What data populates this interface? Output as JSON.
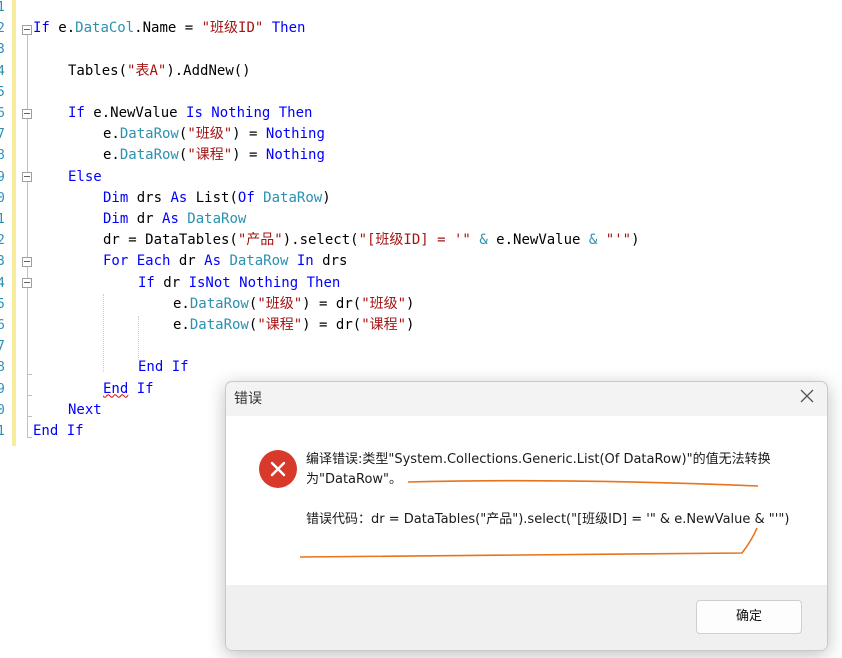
{
  "editor": {
    "line_numbers": [
      "1",
      "2",
      "3",
      "4",
      "5",
      "6",
      "7",
      "8",
      "9",
      "0",
      "1",
      "2",
      "3",
      "4",
      "5",
      "6",
      "7",
      "8",
      "9",
      "0",
      "1"
    ],
    "lines": [
      [],
      [
        [
          "kw",
          "If"
        ],
        [
          "id",
          " e."
        ],
        [
          "typ",
          "DataCol"
        ],
        [
          "id",
          ".Name = "
        ],
        [
          "str",
          "\"班级ID\""
        ],
        [
          "kw",
          " Then"
        ]
      ],
      [],
      [
        [
          "id",
          "Tables("
        ],
        [
          "str",
          "\"表A\""
        ],
        [
          "id",
          ").AddNew()"
        ]
      ],
      [],
      [
        [
          "kw",
          "If"
        ],
        [
          "id",
          " e.NewValue "
        ],
        [
          "kw",
          "Is Nothing Then"
        ]
      ],
      [
        [
          "id",
          "e."
        ],
        [
          "typ",
          "DataRow"
        ],
        [
          "id",
          "("
        ],
        [
          "str",
          "\"班级\""
        ],
        [
          "id",
          ") = "
        ],
        [
          "kw",
          "Nothing"
        ]
      ],
      [
        [
          "id",
          "e."
        ],
        [
          "typ",
          "DataRow"
        ],
        [
          "id",
          "("
        ],
        [
          "str",
          "\"课程\""
        ],
        [
          "id",
          ") = "
        ],
        [
          "kw",
          "Nothing"
        ]
      ],
      [
        [
          "kw",
          "Else"
        ]
      ],
      [
        [
          "kw",
          "Dim"
        ],
        [
          "id",
          " drs "
        ],
        [
          "kw",
          "As"
        ],
        [
          "id",
          " List("
        ],
        [
          "kw",
          "Of"
        ],
        [
          "typ",
          " DataRow"
        ],
        [
          "id",
          ")"
        ]
      ],
      [
        [
          "kw",
          "Dim"
        ],
        [
          "id",
          " dr "
        ],
        [
          "kw",
          "As"
        ],
        [
          "typ",
          " DataRow"
        ]
      ],
      [
        [
          "id",
          "dr = DataTables("
        ],
        [
          "str",
          "\"产品\""
        ],
        [
          "id",
          ").select("
        ],
        [
          "str",
          "\"[班级ID] = '\""
        ],
        [
          "id",
          " "
        ],
        [
          "typ",
          "&"
        ],
        [
          "id",
          " e.NewValue "
        ],
        [
          "typ",
          "&"
        ],
        [
          "str",
          " \"'\""
        ],
        [
          "id",
          ")"
        ]
      ],
      [
        [
          "kw",
          "For Each"
        ],
        [
          "id",
          " dr "
        ],
        [
          "kw",
          "As"
        ],
        [
          "typ",
          " DataRow"
        ],
        [
          "kw",
          " In"
        ],
        [
          "id",
          " drs"
        ]
      ],
      [
        [
          "kw",
          "If"
        ],
        [
          "id",
          " dr "
        ],
        [
          "kw",
          "IsNot Nothing Then"
        ]
      ],
      [
        [
          "id",
          "e."
        ],
        [
          "typ",
          "DataRow"
        ],
        [
          "id",
          "("
        ],
        [
          "str",
          "\"班级\""
        ],
        [
          "id",
          ") = dr("
        ],
        [
          "str",
          "\"班级\""
        ],
        [
          "id",
          ")"
        ]
      ],
      [
        [
          "id",
          "e."
        ],
        [
          "typ",
          "DataRow"
        ],
        [
          "id",
          "("
        ],
        [
          "str",
          "\"课程\""
        ],
        [
          "id",
          ") = dr("
        ],
        [
          "str",
          "\"课程\""
        ],
        [
          "id",
          ")"
        ]
      ],
      [],
      [
        [
          "kw",
          "End If"
        ]
      ],
      [
        [
          "kw",
          "End If"
        ]
      ],
      [
        [
          "kw",
          "Next"
        ]
      ],
      [
        [
          "kw",
          "End If"
        ]
      ]
    ]
  },
  "dialog": {
    "title": "错误",
    "message": "编译错误:类型\"System.Collections.Generic.List(Of DataRow)\"的值无法转换为\"DataRow\"。",
    "error_code": "错误代码：dr = DataTables(\"产品\").select(\"[班级ID] = '\" & e.NewValue & \"'\")",
    "ok_label": "确定"
  },
  "colors": {
    "keyword": "#0000ff",
    "string": "#a31515",
    "type": "#2b91af",
    "error_icon": "#d9392b",
    "annotation": "#e8731a"
  },
  "icons": {
    "close": "close-icon",
    "error": "error-icon"
  }
}
